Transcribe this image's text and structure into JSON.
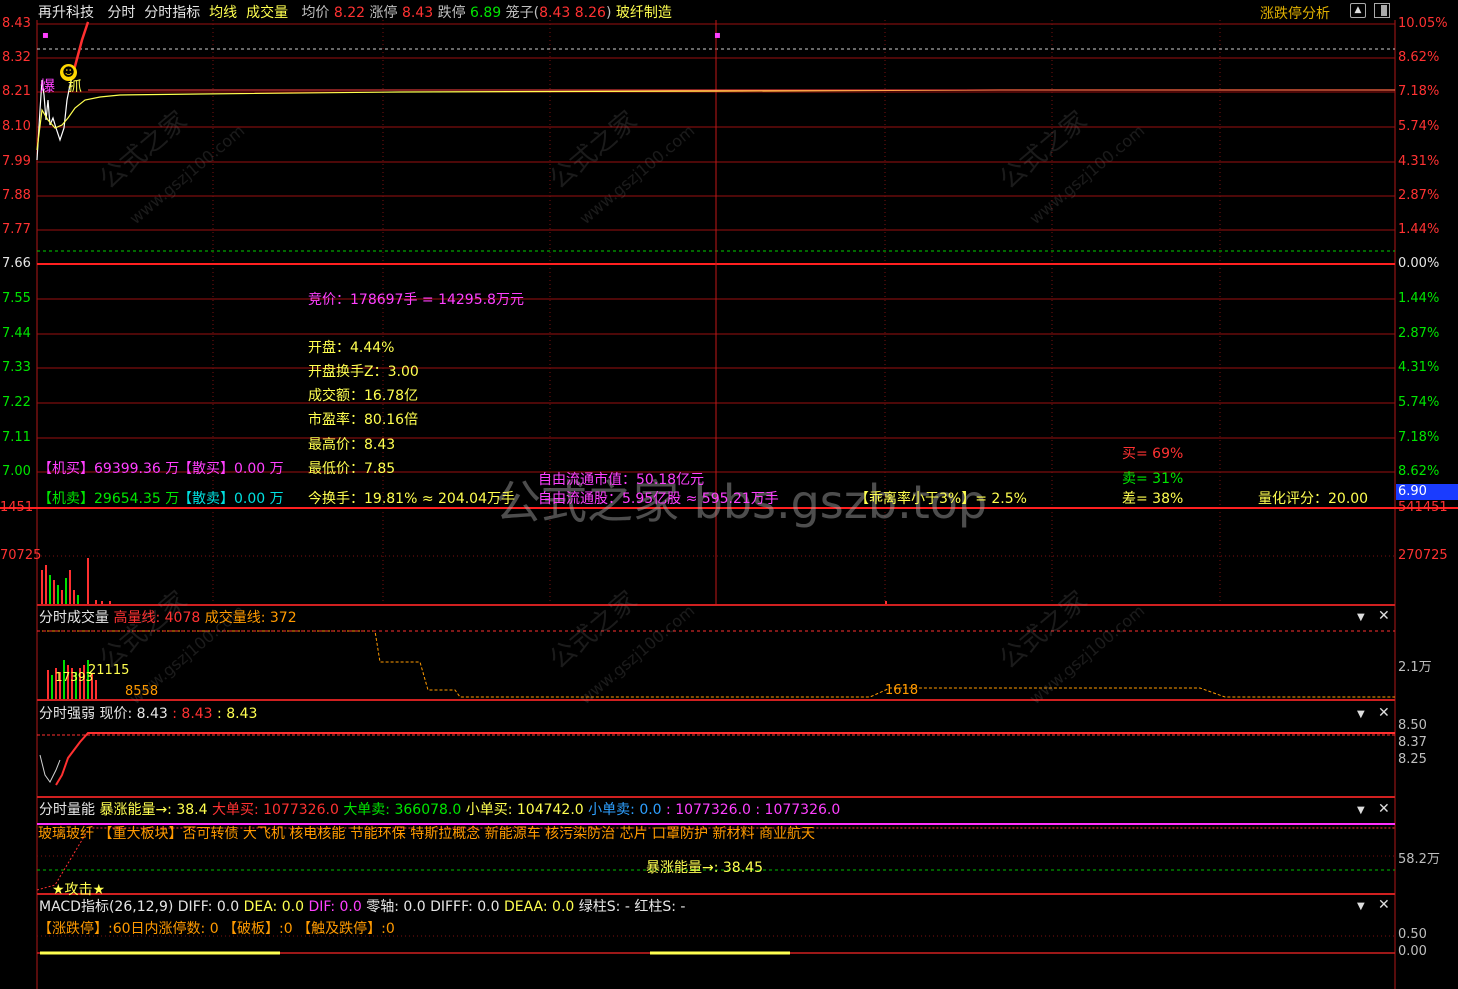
{
  "header": {
    "stock_name": "再升科技",
    "tab_minute": "分时",
    "tab_indicator": "分时指标",
    "avg_label": "均线",
    "volume_label": "成交量",
    "avgprice_label": "均价",
    "avgprice_value": "8.22",
    "limitup_label": "涨停",
    "limitup_value": "8.43",
    "limitdown_label": "跌停",
    "limitdown_value": "6.89",
    "cage_label": "笼子",
    "cage_open": "(",
    "cage_v1": "8.43",
    "cage_v2": "8.26",
    "cage_close": ")",
    "sector": "玻纤制造",
    "analysis_btn": "涨跌停分析"
  },
  "price_axis_left": [
    "8.43",
    "8.32",
    "8.21",
    "8.10",
    "7.99",
    "7.88",
    "7.77",
    "7.66",
    "7.55",
    "7.44",
    "7.33",
    "7.22",
    "7.11",
    "7.00"
  ],
  "pct_axis_right": [
    "10.05%",
    "8.62%",
    "7.18%",
    "5.74%",
    "4.31%",
    "2.87%",
    "1.44%",
    "0.00%",
    "1.44%",
    "2.87%",
    "4.31%",
    "5.74%",
    "7.18%",
    "8.62%"
  ],
  "right_price_tag": "6.90",
  "main_info": {
    "auction": "竞价：178697手 = 14295.8万元",
    "open": "开盘：4.44%",
    "open_turnover": "开盘换手Z：3.00",
    "amount": "成交额：16.78亿",
    "pe": "市盈率：80.16倍",
    "high": "最高价：8.43",
    "low": "最低价：7.85",
    "turnover": "今换手：19.81% ≈ 204.04万手",
    "free_cap": "自由流通市值：50.18亿元",
    "free_share": "自由流通股：5.95亿股 ≈ 595.21万手",
    "deviation": "【乖离率小于3%】= 2.5%",
    "inst_buy": "【机买】69399.36 万",
    "retail_buy": "【散买】0.00 万",
    "inst_sell": "【机卖】29654.35 万",
    "retail_sell": "【散卖】0.00 万",
    "buy_pct": "买= 69%",
    "sell_pct": "卖= 31%",
    "diff_pct": "差= 38%",
    "score": "量化评分：20.00",
    "marker_burst": "爆",
    "marker_grab": "抓"
  },
  "vol_axis": {
    "left_top": "1451",
    "left_mid": "70725",
    "right_top": "541451",
    "right_mid": "270725"
  },
  "panel1": {
    "title": "分时成交量",
    "high_label": "高量线",
    "high_value": "4078",
    "line_label": "成交量线: 372",
    "axis": "2.1万",
    "mid_value": "1618",
    "n1": "21115",
    "n2": "17393",
    "n3": "8558"
  },
  "panel2": {
    "title": "分时强弱",
    "now_label": "现价: 8.43",
    "v1": ": 8.43",
    "v2": ": 8.43",
    "axis": [
      "8.50",
      "8.37",
      "8.25"
    ]
  },
  "panel3": {
    "title": "分时量能",
    "surge": "暴涨能量→: 38.4",
    "big_buy": "大单买: 1077326.0",
    "big_sell": "大单卖: 366078.0",
    "small_buy": "小单买: 104742.0",
    "small_sell": "小单卖: 0.0",
    "v1": ": 1077326.0",
    "v2": ": 1077326.0",
    "concepts": "玻璃玻纤 【重大板块】否可转债 大飞机 核电核能 节能环保 特斯拉概念 新能源车 核污染防治 芯片 口罩防护 新材料 商业航天",
    "surge_mid": "暴涨能量→: 38.45",
    "attack": "★攻击★",
    "axis": "58.2万"
  },
  "panel4": {
    "title": "MACD指标(26,12,9)",
    "diff": "DIFF: 0.0",
    "dea": "DEA: 0.0",
    "dif": "DIF: 0.0",
    "zero": "零轴: 0.0",
    "difff": "DIFFF: 0.0",
    "deaa": "DEAA: 0.0",
    "green": "绿柱S: -",
    "redbar": "红柱S: -",
    "stats": "【涨跌停】:60日内涨停数: 0 【破板】:0 【触及跌停】:0",
    "axis": [
      "0.50",
      "0.00"
    ]
  },
  "watermark": {
    "site": "公式之家",
    "url": "www.gszj100.com",
    "big": "公式之家 bbs.gszb.top"
  },
  "colors": {
    "up": "#ff3232",
    "down": "#00e600",
    "price": "#ffffff",
    "avg": "#ffff50",
    "grid": "#a01010",
    "bg": "#000000"
  }
}
